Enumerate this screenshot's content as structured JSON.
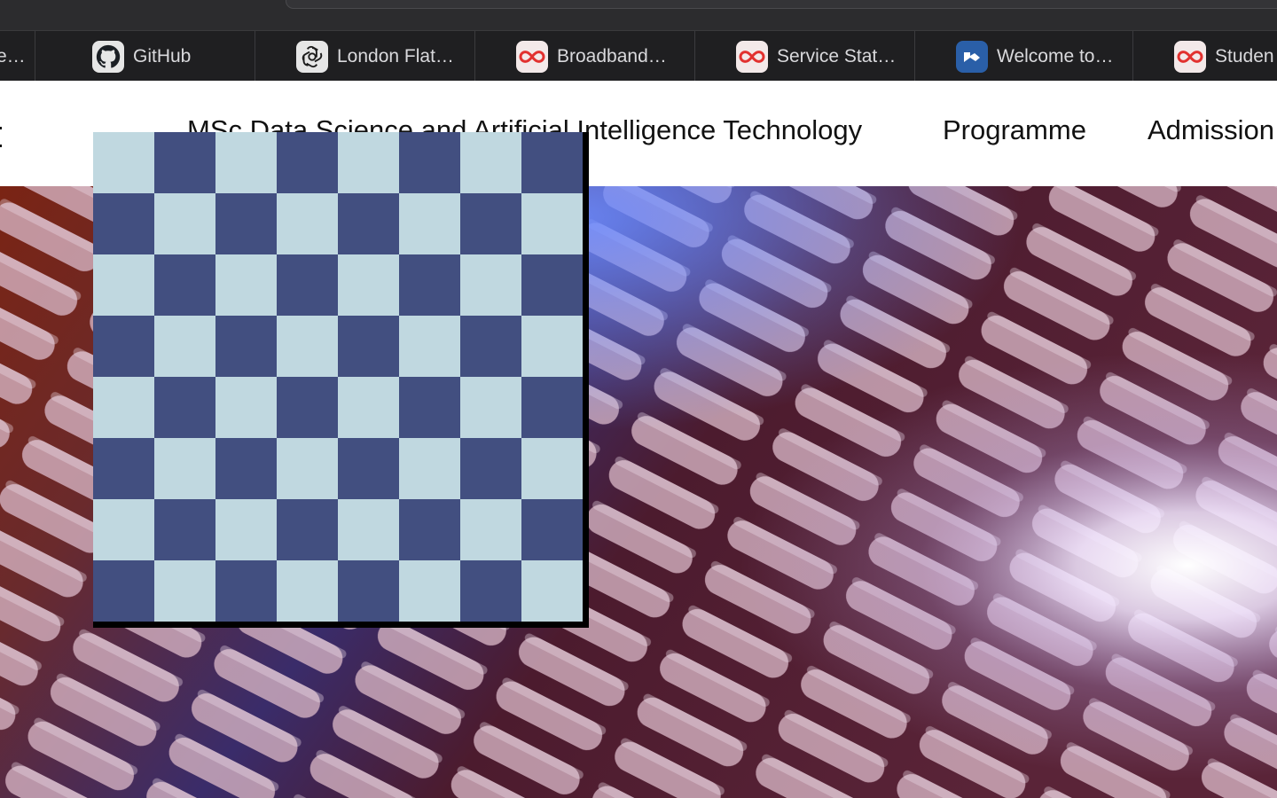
{
  "browser": {
    "tabs": [
      {
        "label": "e…",
        "icon": "generic-page-icon"
      },
      {
        "label": "GitHub",
        "icon": "github-icon"
      },
      {
        "label": "London Flat…",
        "icon": "openai-icon"
      },
      {
        "label": "Broadband…",
        "icon": "virgin-media-icon"
      },
      {
        "label": "Service Stat…",
        "icon": "virgin-media-icon"
      },
      {
        "label": "Welcome to…",
        "icon": "blue-app-icon"
      },
      {
        "label": "Studen",
        "icon": "virgin-media-icon"
      }
    ]
  },
  "site": {
    "nav": {
      "programme_title": "MSc Data Science and Artificial Intelligence Technology",
      "programme": "Programme",
      "admission": "Admission"
    }
  },
  "board": {
    "rows": 8,
    "cols": 8,
    "light_color": "#c0d8e0",
    "dark_color": "#424f80"
  },
  "colors": {
    "chrome_bg": "#1f1f21",
    "tab_text": "#d9d9dc",
    "nav_text": "#111111",
    "accent_virgin": "#e2312f"
  }
}
